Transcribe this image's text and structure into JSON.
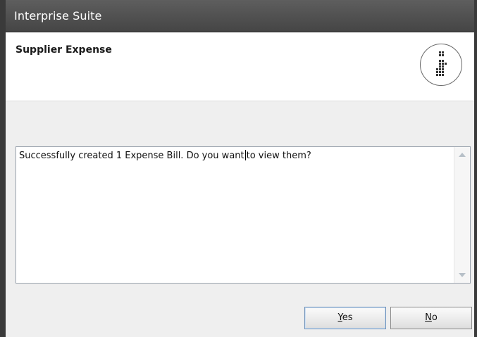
{
  "window": {
    "title": "Interprise Suite"
  },
  "header": {
    "heading": "Supplier Expense",
    "logo_icon": "interprise-logo-icon"
  },
  "message": {
    "text_before_caret": "Successfully created 1 Expense Bill. Do you want",
    "text_after_caret": "to view them?"
  },
  "buttons": {
    "yes": {
      "mnemonic": "Y",
      "rest": "es"
    },
    "no": {
      "mnemonic": "N",
      "rest": "o"
    }
  },
  "colors": {
    "titlebar": "#4f4f4f",
    "accent_border": "#6b8fb8"
  }
}
